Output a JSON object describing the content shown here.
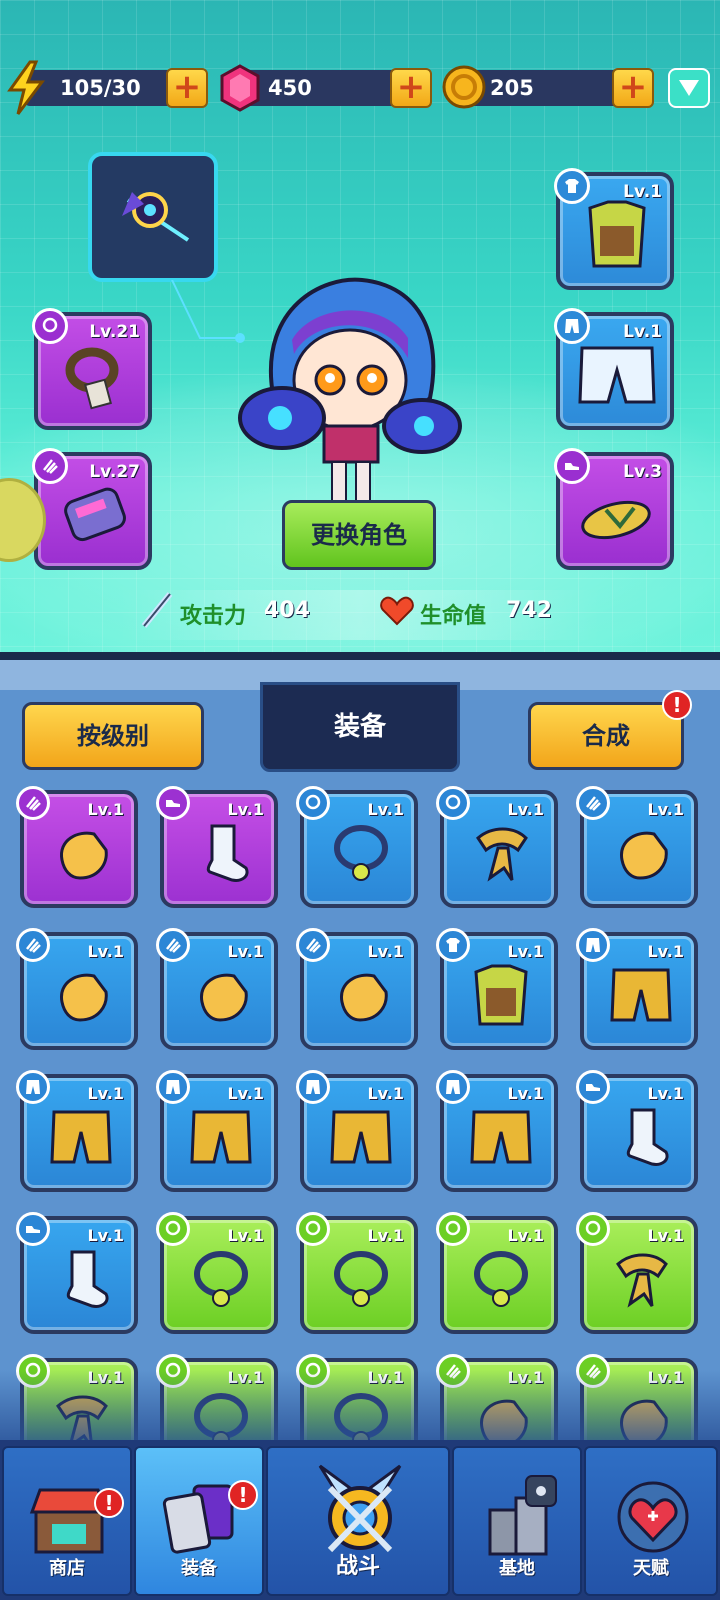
{
  "resources": {
    "energy": "105/30",
    "gems": "450",
    "coins": "205",
    "plus": "+"
  },
  "character": {
    "change_label": "更换角色",
    "attack_label": "攻击力",
    "attack_value": "404",
    "hp_label": "生命值",
    "hp_value": "742"
  },
  "equipped": {
    "necklace_lv": "Lv.21",
    "gloves_lv": "Lv.27",
    "armor_lv": "Lv.1",
    "pants_lv": "Lv.1",
    "shoes_lv": "Lv.3"
  },
  "inventory": {
    "sort_label": "按级别",
    "tab_label": "装备",
    "synth_label": "合成",
    "alert": "!",
    "items": [
      {
        "lv": "Lv.1",
        "rarity": "purple",
        "kind": "glove"
      },
      {
        "lv": "Lv.1",
        "rarity": "purple",
        "kind": "sock"
      },
      {
        "lv": "Lv.1",
        "rarity": "blue",
        "kind": "necklace"
      },
      {
        "lv": "Lv.1",
        "rarity": "blue",
        "kind": "scarf"
      },
      {
        "lv": "Lv.1",
        "rarity": "blue",
        "kind": "glove"
      },
      {
        "lv": "Lv.1",
        "rarity": "blue",
        "kind": "glove"
      },
      {
        "lv": "Lv.1",
        "rarity": "blue",
        "kind": "glove"
      },
      {
        "lv": "Lv.1",
        "rarity": "blue",
        "kind": "glove"
      },
      {
        "lv": "Lv.1",
        "rarity": "blue",
        "kind": "armor"
      },
      {
        "lv": "Lv.1",
        "rarity": "blue",
        "kind": "pants"
      },
      {
        "lv": "Lv.1",
        "rarity": "blue",
        "kind": "pants"
      },
      {
        "lv": "Lv.1",
        "rarity": "blue",
        "kind": "pants"
      },
      {
        "lv": "Lv.1",
        "rarity": "blue",
        "kind": "pants"
      },
      {
        "lv": "Lv.1",
        "rarity": "blue",
        "kind": "pants"
      },
      {
        "lv": "Lv.1",
        "rarity": "blue",
        "kind": "sock"
      },
      {
        "lv": "Lv.1",
        "rarity": "blue",
        "kind": "sock"
      },
      {
        "lv": "Lv.1",
        "rarity": "green",
        "kind": "necklace"
      },
      {
        "lv": "Lv.1",
        "rarity": "green",
        "kind": "necklace"
      },
      {
        "lv": "Lv.1",
        "rarity": "green",
        "kind": "necklace"
      },
      {
        "lv": "Lv.1",
        "rarity": "green",
        "kind": "scarf"
      },
      {
        "lv": "Lv.1",
        "rarity": "green",
        "kind": "scarf"
      },
      {
        "lv": "Lv.1",
        "rarity": "green",
        "kind": "necklace"
      },
      {
        "lv": "Lv.1",
        "rarity": "green",
        "kind": "necklace"
      },
      {
        "lv": "Lv.1",
        "rarity": "green",
        "kind": "glove"
      },
      {
        "lv": "Lv.1",
        "rarity": "green",
        "kind": "glove"
      }
    ]
  },
  "nav": {
    "shop": "商店",
    "equipment": "装备",
    "battle": "战斗",
    "base": "基地",
    "talent": "天赋"
  },
  "colors": {
    "purple": "#9c31d1",
    "blue": "#2b86d6",
    "green": "#6ccf24",
    "gold_button": "#f2a51a",
    "alert": "#e02424"
  }
}
